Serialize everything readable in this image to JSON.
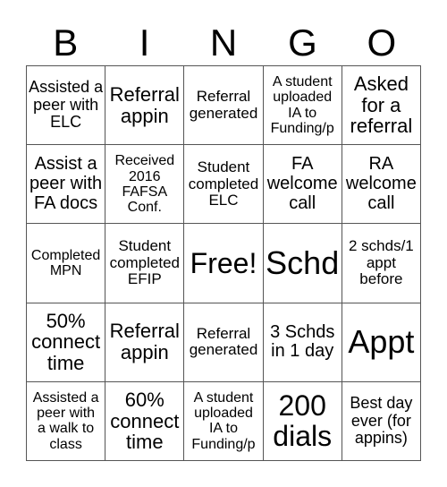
{
  "header": {
    "letters": [
      "B",
      "I",
      "N",
      "G",
      "O"
    ]
  },
  "board": {
    "cells": [
      "Assisted a\npeer with\nELC",
      "Referral\nappin",
      "Referral\ngenerated",
      "A student\nuploaded\nIA to\nFunding/p",
      "Asked\nfor a\nreferral",
      "Assist a\npeer with\nFA docs",
      "Received\n2016\nFAFSA\nConf.",
      "Student\ncompleted\nELC",
      "FA\nwelcome\ncall",
      "RA\nwelcome\ncall",
      "Completed\nMPN",
      "Student\ncompleted\nEFIP",
      "Free!",
      "Schd",
      "2 schds/1\nappt\nbefore",
      "50%\nconnect\ntime",
      "Referral\nappin",
      "Referral\ngenerated",
      "3 Schds\nin 1 day",
      "Appt",
      "Assisted a\npeer with\na walk to\nclass",
      "60%\nconnect\ntime",
      "A student\nuploaded\nIA to\nFunding/p",
      "200\ndials",
      "Best day\never (for\nappins)"
    ]
  }
}
